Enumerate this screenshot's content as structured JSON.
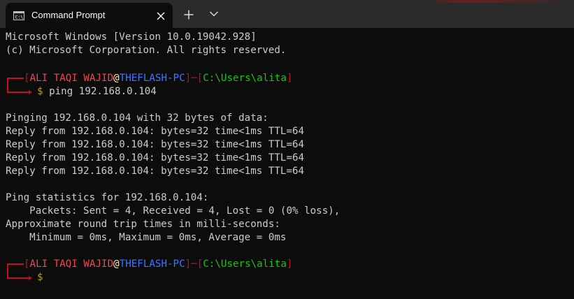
{
  "window": {
    "tab_title": "Command Prompt",
    "tab_icon": "cmd-icon",
    "close_icon": "close-icon",
    "new_tab_icon": "plus-icon",
    "dropdown_icon": "chevron-down-icon"
  },
  "colors": {
    "background": "#0c0c0c",
    "tabbar": "#2b2b2b",
    "prompt_red": "#c50f1f",
    "user_red": "#e74856",
    "host_blue": "#3b78ff",
    "path_green": "#16c60c",
    "dollar_gold": "#c19c00",
    "text": "#cccccc"
  },
  "terminal": {
    "header1": "Microsoft Windows [Version 10.0.19042.928]",
    "header2": "(c) Microsoft Corporation. All rights reserved.",
    "prompt1": {
      "open": "[",
      "user": "ALI TAQI WAJID",
      "at": "@",
      "host": "THEFLASH-PC",
      "mid": "]─[",
      "path": "C:\\Users\\alita",
      "close": "]",
      "dollar": "$",
      "command": "ping 192.168.0.104"
    },
    "output": [
      "Pinging 192.168.0.104 with 32 bytes of data:",
      "Reply from 192.168.0.104: bytes=32 time<1ms TTL=64",
      "Reply from 192.168.0.104: bytes=32 time<1ms TTL=64",
      "Reply from 192.168.0.104: bytes=32 time<1ms TTL=64",
      "Reply from 192.168.0.104: bytes=32 time<1ms TTL=64",
      "",
      "Ping statistics for 192.168.0.104:",
      "    Packets: Sent = 4, Received = 4, Lost = 0 (0% loss),",
      "Approximate round trip times in milli-seconds:",
      "    Minimum = 0ms, Maximum = 0ms, Average = 0ms"
    ],
    "prompt2": {
      "open": "[",
      "user": "ALI TAQI WAJID",
      "at": "@",
      "host": "THEFLASH-PC",
      "mid": "]─[",
      "path": "C:\\Users\\alita",
      "close": "]",
      "dollar": "$",
      "command": ""
    }
  }
}
